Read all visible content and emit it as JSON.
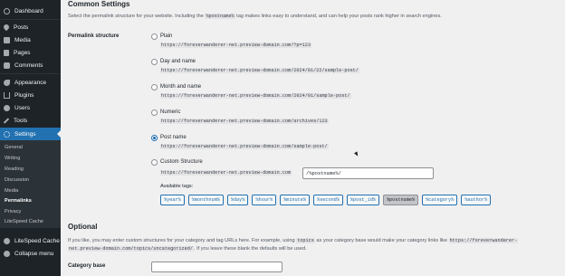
{
  "sidebar": {
    "items": [
      {
        "label": "Dashboard",
        "icon": "dashboard-icon"
      },
      {
        "label": "Posts",
        "icon": "pin-icon"
      },
      {
        "label": "Media",
        "icon": "media-icon"
      },
      {
        "label": "Pages",
        "icon": "page-icon"
      },
      {
        "label": "Comments",
        "icon": "comment-icon"
      },
      {
        "label": "Appearance",
        "icon": "brush-icon"
      },
      {
        "label": "Plugins",
        "icon": "plugin-icon"
      },
      {
        "label": "Users",
        "icon": "user-icon"
      },
      {
        "label": "Tools",
        "icon": "wrench-icon"
      },
      {
        "label": "Settings",
        "icon": "settings-icon"
      }
    ],
    "submenu": [
      "General",
      "Writing",
      "Reading",
      "Discussion",
      "Media",
      "Permalinks",
      "Privacy",
      "LiteSpeed Cache"
    ],
    "current_submenu": "Permalinks",
    "litespeed": "LiteSpeed Cache",
    "collapse": "Collapse menu"
  },
  "main": {
    "heading": "Common Settings",
    "desc_before": "Select the permalink structure for your website. Including the",
    "desc_code": "%postname%",
    "desc_after": "tag makes links easy to understand, and can help your posts rank higher in search engines.",
    "structure_label": "Permalink structure",
    "options": [
      {
        "title": "Plain",
        "url": "https://foreverwanderer-net.preview-domain.com/?p=123",
        "checked": false
      },
      {
        "title": "Day and name",
        "url": "https://foreverwanderer-net.preview-domain.com/2024/01/22/sample-post/",
        "checked": false
      },
      {
        "title": "Month and name",
        "url": "https://foreverwanderer-net.preview-domain.com/2024/01/sample-post/",
        "checked": false
      },
      {
        "title": "Numeric",
        "url": "https://foreverwanderer-net.preview-domain.com/archives/123",
        "checked": false
      },
      {
        "title": "Post name",
        "url": "https://foreverwanderer-net.preview-domain.com/sample-post/",
        "checked": true
      },
      {
        "title": "Custom Structure",
        "url": "https://foreverwanderer-net.preview-domain.com",
        "checked": false
      }
    ],
    "custom_value": "/%postname%/",
    "available_tags_label": "Available tags:",
    "tags": [
      "%year%",
      "%monthnum%",
      "%day%",
      "%hour%",
      "%minute%",
      "%second%",
      "%post_id%",
      "%postname%",
      "%category%",
      "%author%"
    ],
    "selected_tag": "%postname%",
    "optional_heading": "Optional",
    "optional_desc_1": "If you like, you may enter custom structures for your category and tag URLs here. For example, using",
    "optional_code_1": "topics",
    "optional_desc_2": "as your category base would make your category links like",
    "optional_code_2a": "https://foreverwanderer-",
    "optional_code_2b": "net.preview-domain.com/topics/uncategorized/",
    "optional_desc_3": ". If you leave these blank the defaults will be used.",
    "category_base_label": "Category base",
    "category_base_value": ""
  },
  "colors": {
    "sidebar_bg": "#1d2327",
    "accent": "#2271b1",
    "page_bg": "#f0f0f1"
  }
}
